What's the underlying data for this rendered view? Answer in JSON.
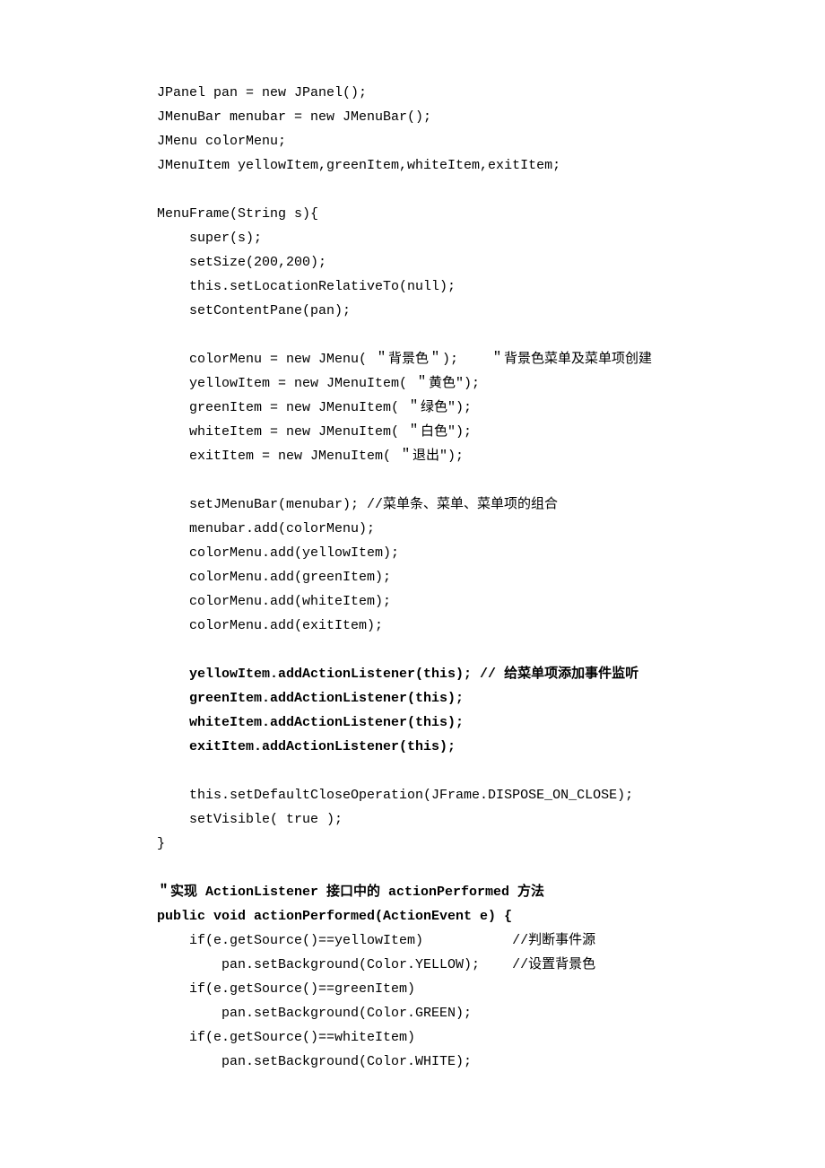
{
  "lines": [
    {
      "text": "JPanel pan = new JPanel();",
      "indent": 0,
      "bold": false
    },
    {
      "text": "JMenuBar menubar = new JMenuBar();",
      "indent": 0,
      "bold": false
    },
    {
      "text": "JMenu colorMenu;",
      "indent": 0,
      "bold": false
    },
    {
      "text": "JMenuItem yellowItem,greenItem,whiteItem,exitItem;",
      "indent": 0,
      "bold": false
    },
    {
      "text": "",
      "indent": 0,
      "bold": false
    },
    {
      "text": "MenuFrame(String s){",
      "indent": 0,
      "bold": false
    },
    {
      "text": "super(s);",
      "indent": 1,
      "bold": false
    },
    {
      "text": "setSize(200,200);",
      "indent": 1,
      "bold": false
    },
    {
      "text": "this.setLocationRelativeTo(null);",
      "indent": 1,
      "bold": false
    },
    {
      "text": "setContentPane(pan);",
      "indent": 1,
      "bold": false
    },
    {
      "text": "",
      "indent": 1,
      "bold": false
    },
    {
      "text": "colorMenu = new JMenu( ＂背景色＂);    ＂背景色菜单及菜单项创建",
      "indent": 1,
      "bold": false
    },
    {
      "text": "yellowItem = new JMenuItem( ＂黄色\");",
      "indent": 1,
      "bold": false
    },
    {
      "text": "greenItem = new JMenuItem( ＂绿色\");",
      "indent": 1,
      "bold": false
    },
    {
      "text": "whiteItem = new JMenuItem( ＂白色\");",
      "indent": 1,
      "bold": false
    },
    {
      "text": "exitItem = new JMenuItem( ＂退出\");",
      "indent": 1,
      "bold": false
    },
    {
      "text": "",
      "indent": 1,
      "bold": false
    },
    {
      "text": "setJMenuBar(menubar); //菜单条、菜单、菜单项的组合",
      "indent": 1,
      "bold": false
    },
    {
      "text": "menubar.add(colorMenu);",
      "indent": 1,
      "bold": false
    },
    {
      "text": "colorMenu.add(yellowItem);",
      "indent": 1,
      "bold": false
    },
    {
      "text": "colorMenu.add(greenItem);",
      "indent": 1,
      "bold": false
    },
    {
      "text": "colorMenu.add(whiteItem);",
      "indent": 1,
      "bold": false
    },
    {
      "text": "colorMenu.add(exitItem);",
      "indent": 1,
      "bold": false
    },
    {
      "text": "",
      "indent": 1,
      "bold": false
    },
    {
      "text": "yellowItem.addActionListener(this); // 给菜单项添加事件监听",
      "indent": 1,
      "bold": true
    },
    {
      "text": "greenItem.addActionListener(this);",
      "indent": 1,
      "bold": true
    },
    {
      "text": "whiteItem.addActionListener(this);",
      "indent": 1,
      "bold": true
    },
    {
      "text": "exitItem.addActionListener(this);",
      "indent": 1,
      "bold": true
    },
    {
      "text": "",
      "indent": 1,
      "bold": false
    },
    {
      "text": "this.setDefaultCloseOperation(JFrame.DISPOSE_ON_CLOSE);",
      "indent": 1,
      "bold": false
    },
    {
      "text": "setVisible( true );",
      "indent": 1,
      "bold": false
    },
    {
      "text": "}",
      "indent": 0,
      "bold": false
    },
    {
      "text": "",
      "indent": 0,
      "bold": false
    },
    {
      "text": "＂实现 ActionListener 接口中的 actionPerformed 方法",
      "indent": 0,
      "bold": true
    },
    {
      "text": "public void actionPerformed(ActionEvent e) {",
      "indent": 0,
      "bold": true
    },
    {
      "text": "if(e.getSource()==yellowItem)           //判断事件源",
      "indent": 1,
      "bold": false
    },
    {
      "text": "pan.setBackground(Color.YELLOW);    //设置背景色",
      "indent": 2,
      "bold": false
    },
    {
      "text": "if(e.getSource()==greenItem)",
      "indent": 1,
      "bold": false
    },
    {
      "text": "pan.setBackground(Color.GREEN);",
      "indent": 2,
      "bold": false
    },
    {
      "text": "if(e.getSource()==whiteItem)",
      "indent": 1,
      "bold": false
    },
    {
      "text": "pan.setBackground(Color.WHITE);",
      "indent": 2,
      "bold": false
    }
  ],
  "indentUnit": "    "
}
